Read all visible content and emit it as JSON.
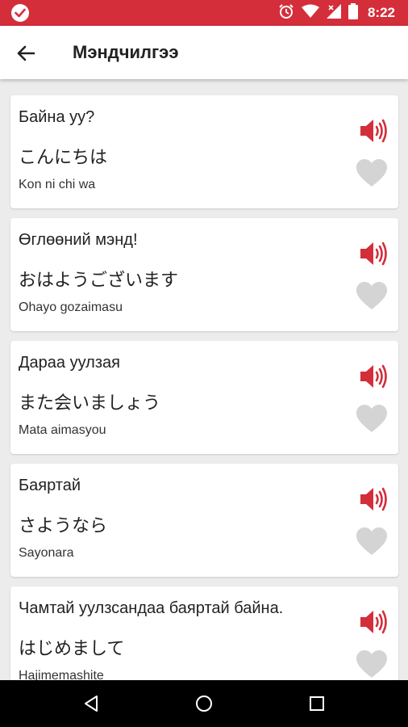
{
  "status_bar": {
    "time": "8:22",
    "icons": [
      "app-badge-icon",
      "alarm-icon",
      "wifi-icon",
      "signal-icon",
      "battery-icon"
    ]
  },
  "app_bar": {
    "title": "Мэндчилгээ",
    "back_icon": "arrow-left-icon"
  },
  "colors": {
    "status_bar": "#d32e3a",
    "accent": "#d32e3a",
    "favorite_inactive": "#d4d4d4",
    "background": "#ececec"
  },
  "phrases": [
    {
      "mongolian": "Байна уу?",
      "japanese": "こんにちは",
      "romaji": "Kon ni chi wa"
    },
    {
      "mongolian": "Өглөөний мэнд!",
      "japanese": "おはようございます",
      "romaji": "Ohayo gozaimasu"
    },
    {
      "mongolian": "Дараа уулзая",
      "japanese": "また会いましょう",
      "romaji": "Mata aimasyou"
    },
    {
      "mongolian": "Баяртай",
      "japanese": "さようなら",
      "romaji": "Sayonara"
    },
    {
      "mongolian": "Чамтай уулзсандаа баяртай байна.",
      "japanese": "はじめまして",
      "romaji": "Hajimemashite"
    }
  ],
  "nav_bar": {
    "icons": [
      "back-triangle-icon",
      "home-circle-icon",
      "recents-square-icon"
    ]
  }
}
